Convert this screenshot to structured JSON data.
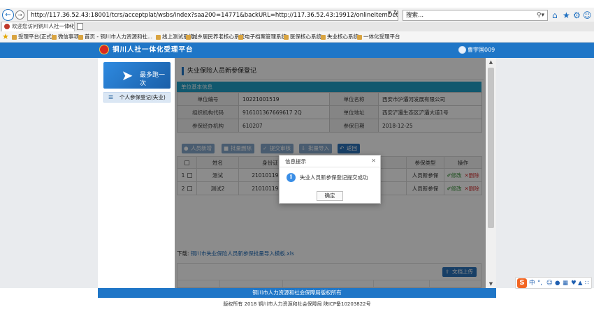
{
  "browser": {
    "url": "http://117.36.52.43:18001/tcrs/acceptplat/wsbs/index?saa200=14771&backURL=http://117.36.52.43:19912/onlineItemDetail.jspx&szz046=00000266&amp;",
    "search_placeholder": "搜索...",
    "tab_title": "欢迎您访问铜川人社一体化...",
    "favorites": [
      "受理平台(正式)",
      "微信事项",
      "首页 - 铜川市人力资源和社...",
      "线上测试系统",
      "城乡居民养老核心系统",
      "电子档案管理系统",
      "医保核心系统",
      "失业核心系统",
      "一体化受理平台"
    ]
  },
  "header": {
    "title": "铜川人社一体化受理平台",
    "user_name": "曹宇国009"
  },
  "sidebar": {
    "slogan": "最多跑一次",
    "items": [
      {
        "label": "个人参保登记(失业)"
      }
    ]
  },
  "main": {
    "page_title": "失业保险人员新参保登记",
    "section_title": "单位基本信息",
    "unit_info": {
      "unit_code_label": "单位编号",
      "unit_code": "10221001519",
      "unit_name_label": "单位名称",
      "unit_name": "西安市沪灞河发展有限公司",
      "org_code_label": "组织机构代码",
      "org_code": "916101367669617 2Q",
      "address_label": "单位地址",
      "address": "西安浐灞生态区浐灞大道1号",
      "agency_label": "参保经办机构",
      "agency": "610207",
      "date_label": "参保日期",
      "date": "2018-12-25"
    },
    "toolbar": {
      "add": "人员新增",
      "batch_delete": "批量删除",
      "submit": "提交审核",
      "batch_import": "批量导入",
      "back": "返回"
    },
    "grid": {
      "headers": [
        "姓名",
        "身份证",
        "",
        "参保类型",
        "操作"
      ],
      "edit_label": "修改",
      "delete_label": "删除",
      "rows": [
        {
          "no": "1",
          "name": "测试",
          "id_number": "21010119800",
          "type": "人员新参保"
        },
        {
          "no": "2",
          "name": "测试2",
          "id_number": "21010119800",
          "type": "人员新参保"
        }
      ]
    },
    "download": {
      "label": "下载:",
      "link": "铜川市失业保险人员新参保批量导入模板.xls"
    },
    "upload_label": "文档上传"
  },
  "dialog": {
    "title": "信息提示",
    "message": "失业人员新参保登记提交成功",
    "ok_label": "确定"
  },
  "footer": {
    "owner": "铜川市人力资源和社会保障局版权所有",
    "copyright": "版权所有 2018 铜川市人力资源和社会保障局 陕ICP备10203822号"
  }
}
